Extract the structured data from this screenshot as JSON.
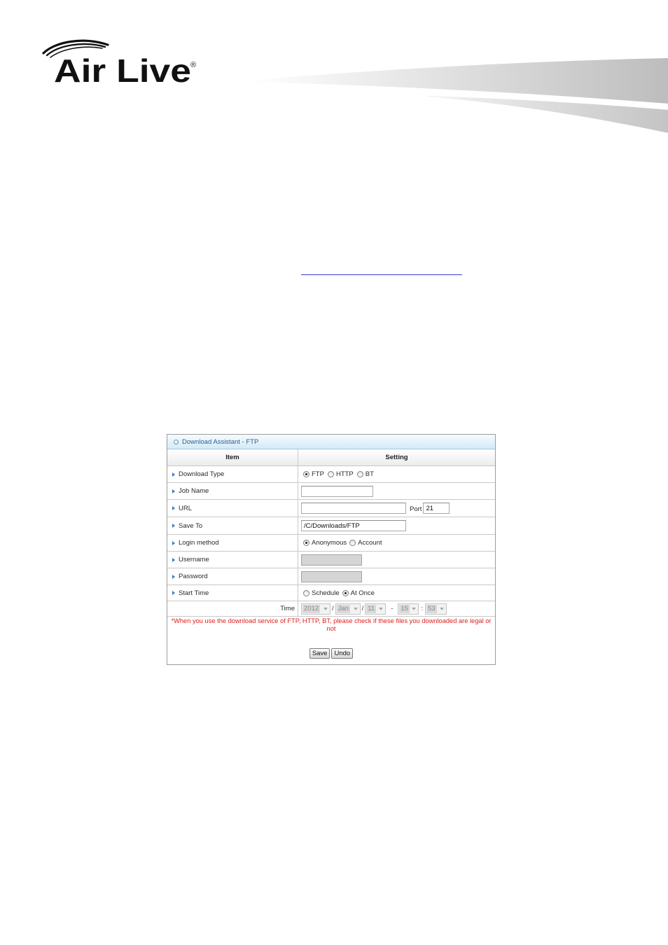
{
  "logo": {
    "text": "Air Live",
    "mark": "®"
  },
  "panel": {
    "title": "Download Assistant - FTP",
    "columns": {
      "item": "Item",
      "setting": "Setting"
    },
    "download_type": {
      "label": "Download Type",
      "options": [
        {
          "label": "FTP",
          "checked": true
        },
        {
          "label": "HTTP",
          "checked": false
        },
        {
          "label": "BT",
          "checked": false
        }
      ]
    },
    "job_name": {
      "label": "Job Name",
      "value": ""
    },
    "url": {
      "label": "URL",
      "value": "",
      "port_label": "Port",
      "port_value": "21"
    },
    "save_to": {
      "label": "Save To",
      "value": "/C/Downloads/FTP"
    },
    "login_method": {
      "label": "Login method",
      "options": [
        {
          "label": "Anonymous",
          "checked": true
        },
        {
          "label": "Account",
          "checked": false
        }
      ]
    },
    "username": {
      "label": "Username",
      "value": "",
      "disabled": true
    },
    "password": {
      "label": "Password",
      "value": "",
      "disabled": true
    },
    "start_time": {
      "label": "Start Time",
      "options": [
        {
          "label": "Schedule",
          "checked": false
        },
        {
          "label": "At Once",
          "checked": true
        }
      ]
    },
    "time": {
      "label": "Time",
      "year": "2012",
      "month": "Jan",
      "day": "11",
      "hour": "15",
      "minute": "53",
      "sep_date_1": "/",
      "sep_date_2": "/",
      "sep_date_time": "-",
      "sep_time": ":",
      "disabled": true
    },
    "note": "*When you use the download service of FTP, HTTP, BT, please check if these files you downloaded are legal or not",
    "buttons": {
      "save": "Save",
      "undo": "Undo"
    }
  },
  "icons": {
    "panel_header": "bullet-circle-icon",
    "row_marker": "triangle-right-icon",
    "select_arrow": "chevron-down-icon"
  },
  "colors": {
    "header_bg": "#d4eaf7",
    "title_text": "#2b5f8e",
    "row_marker": "#3b7dc4",
    "note_text": "#e31b1b",
    "link": "#3b3bd6"
  }
}
